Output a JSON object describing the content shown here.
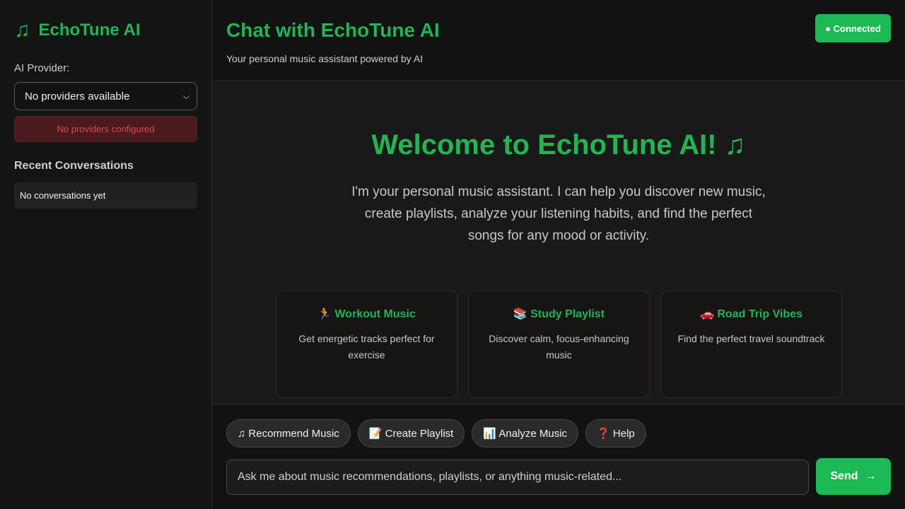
{
  "sidebar": {
    "brand_icon": "♫",
    "brand_title": "EchoTune AI",
    "provider_label": "AI Provider:",
    "provider_selected": "No providers available",
    "provider_error": "No providers configured",
    "recent_title": "Recent Conversations",
    "recent_empty": "No conversations yet"
  },
  "header": {
    "title": "Chat with EchoTune AI",
    "subtitle": "Your personal music assistant powered by AI",
    "status": "● Connected"
  },
  "welcome": {
    "title": "Welcome to EchoTune AI! ♫",
    "text": "I'm your personal music assistant. I can help you discover new music, create playlists, analyze your listening habits, and find the perfect songs for any mood or activity."
  },
  "cards": [
    {
      "title": "🏃 Workout Music",
      "desc": "Get energetic tracks perfect for exercise"
    },
    {
      "title": "📚 Study Playlist",
      "desc": "Discover calm, focus-enhancing music"
    },
    {
      "title": "🚗 Road Trip Vibes",
      "desc": "Find the perfect travel soundtrack"
    }
  ],
  "quick_actions": [
    "♫ Recommend Music",
    "📝 Create Playlist",
    "📊 Analyze Music",
    "❓ Help"
  ],
  "composer": {
    "placeholder": "Ask me about music recommendations, playlists, or anything music-related...",
    "send_label": "Send",
    "send_arrow": "→"
  },
  "colors": {
    "accent": "#1db954",
    "background": "#181818",
    "error": "#e04a4a"
  }
}
